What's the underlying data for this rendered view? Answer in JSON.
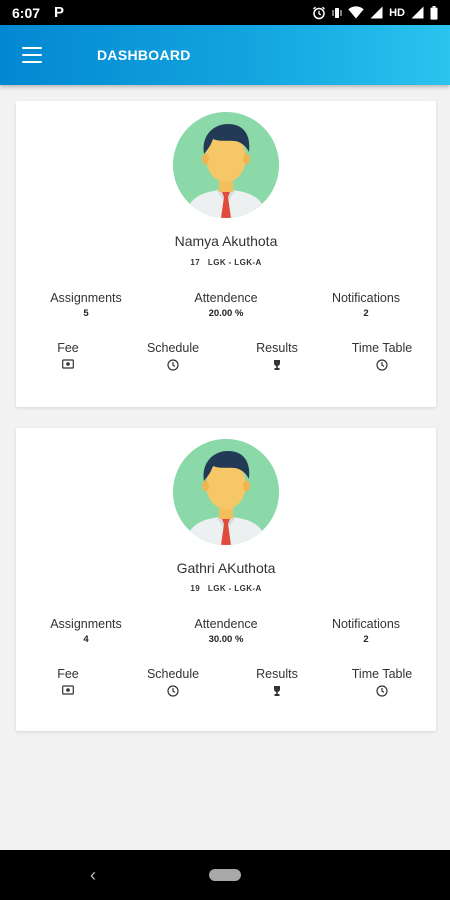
{
  "status_bar": {
    "time": "6:07",
    "app_indicator": "P",
    "network": "HD",
    "icons": [
      "alarm-icon",
      "vibrate-icon",
      "wifi-icon",
      "signal-icon",
      "battery-icon"
    ]
  },
  "app_bar": {
    "title": "DASHBOARD",
    "menu_icon": "menu-icon",
    "colors": {
      "start": "#0288d1",
      "end": "#2bc3ef"
    }
  },
  "students": [
    {
      "name": "Namya Akuthota",
      "sub": "17   LGK - LGK-A",
      "stats": [
        {
          "label": "Assignments",
          "value": "5"
        },
        {
          "label": "Attendence",
          "value": "20.00 %"
        },
        {
          "label": "Notifications",
          "value": "2"
        }
      ],
      "actions": [
        {
          "label": "Fee",
          "icon": "fee-icon"
        },
        {
          "label": "Schedule",
          "icon": "clock-icon"
        },
        {
          "label": "Results",
          "icon": "trophy-icon"
        },
        {
          "label": "Time Table",
          "icon": "clock-icon"
        }
      ]
    },
    {
      "name": "Gathri AKuthota",
      "sub": "19   LGK - LGK-A",
      "stats": [
        {
          "label": "Assignments",
          "value": "4"
        },
        {
          "label": "Attendence",
          "value": "30.00 %"
        },
        {
          "label": "Notifications",
          "value": "2"
        }
      ],
      "actions": [
        {
          "label": "Fee",
          "icon": "fee-icon"
        },
        {
          "label": "Schedule",
          "icon": "clock-icon"
        },
        {
          "label": "Results",
          "icon": "trophy-icon"
        },
        {
          "label": "Time Table",
          "icon": "clock-icon"
        }
      ]
    }
  ],
  "nav_bar": {
    "icons": [
      "back-icon",
      "home-pill-icon"
    ]
  }
}
